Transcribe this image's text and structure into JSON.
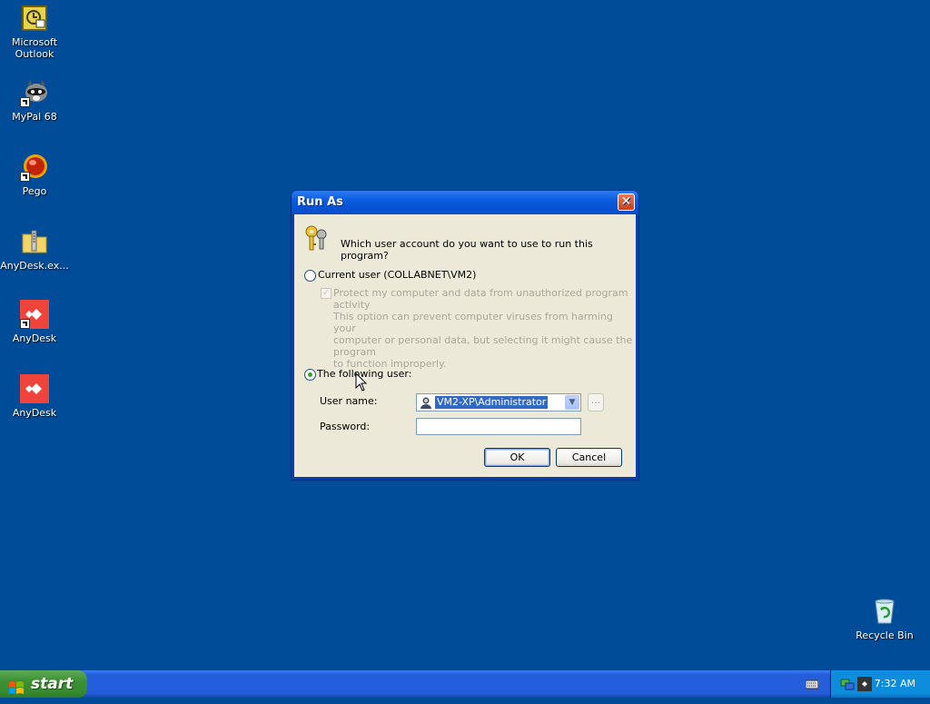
{
  "desktop": {
    "icons": [
      {
        "label_line1": "Microsoft",
        "label_line2": "Outlook"
      },
      {
        "label": "MyPal 68"
      },
      {
        "label": "Pego"
      },
      {
        "label": "AnyDesk.ex..."
      },
      {
        "label": "AnyDesk"
      },
      {
        "label": "AnyDesk"
      },
      {
        "label": "Recycle Bin"
      }
    ]
  },
  "dialog": {
    "title": "Run As",
    "question": "Which user account do you want to use to run this program?",
    "current_user_label": "Current user (COLLABNET\\VM2)",
    "protect_label": "Protect my computer and data from unauthorized program activity",
    "help_line1": "This option can prevent computer viruses from harming your",
    "help_line2": "computer or personal data, but selecting it might cause the program",
    "help_line3": "to function improperly.",
    "following_user_label": "The following user:",
    "username_label": "User name:",
    "username_value": "VM2-XP\\Administrator",
    "password_label": "Password:",
    "browse_label": "...",
    "ok_label": "OK",
    "cancel_label": "Cancel",
    "close_glyph": "✕"
  },
  "taskbar": {
    "start_label": "start",
    "clock": "7:32 AM"
  }
}
